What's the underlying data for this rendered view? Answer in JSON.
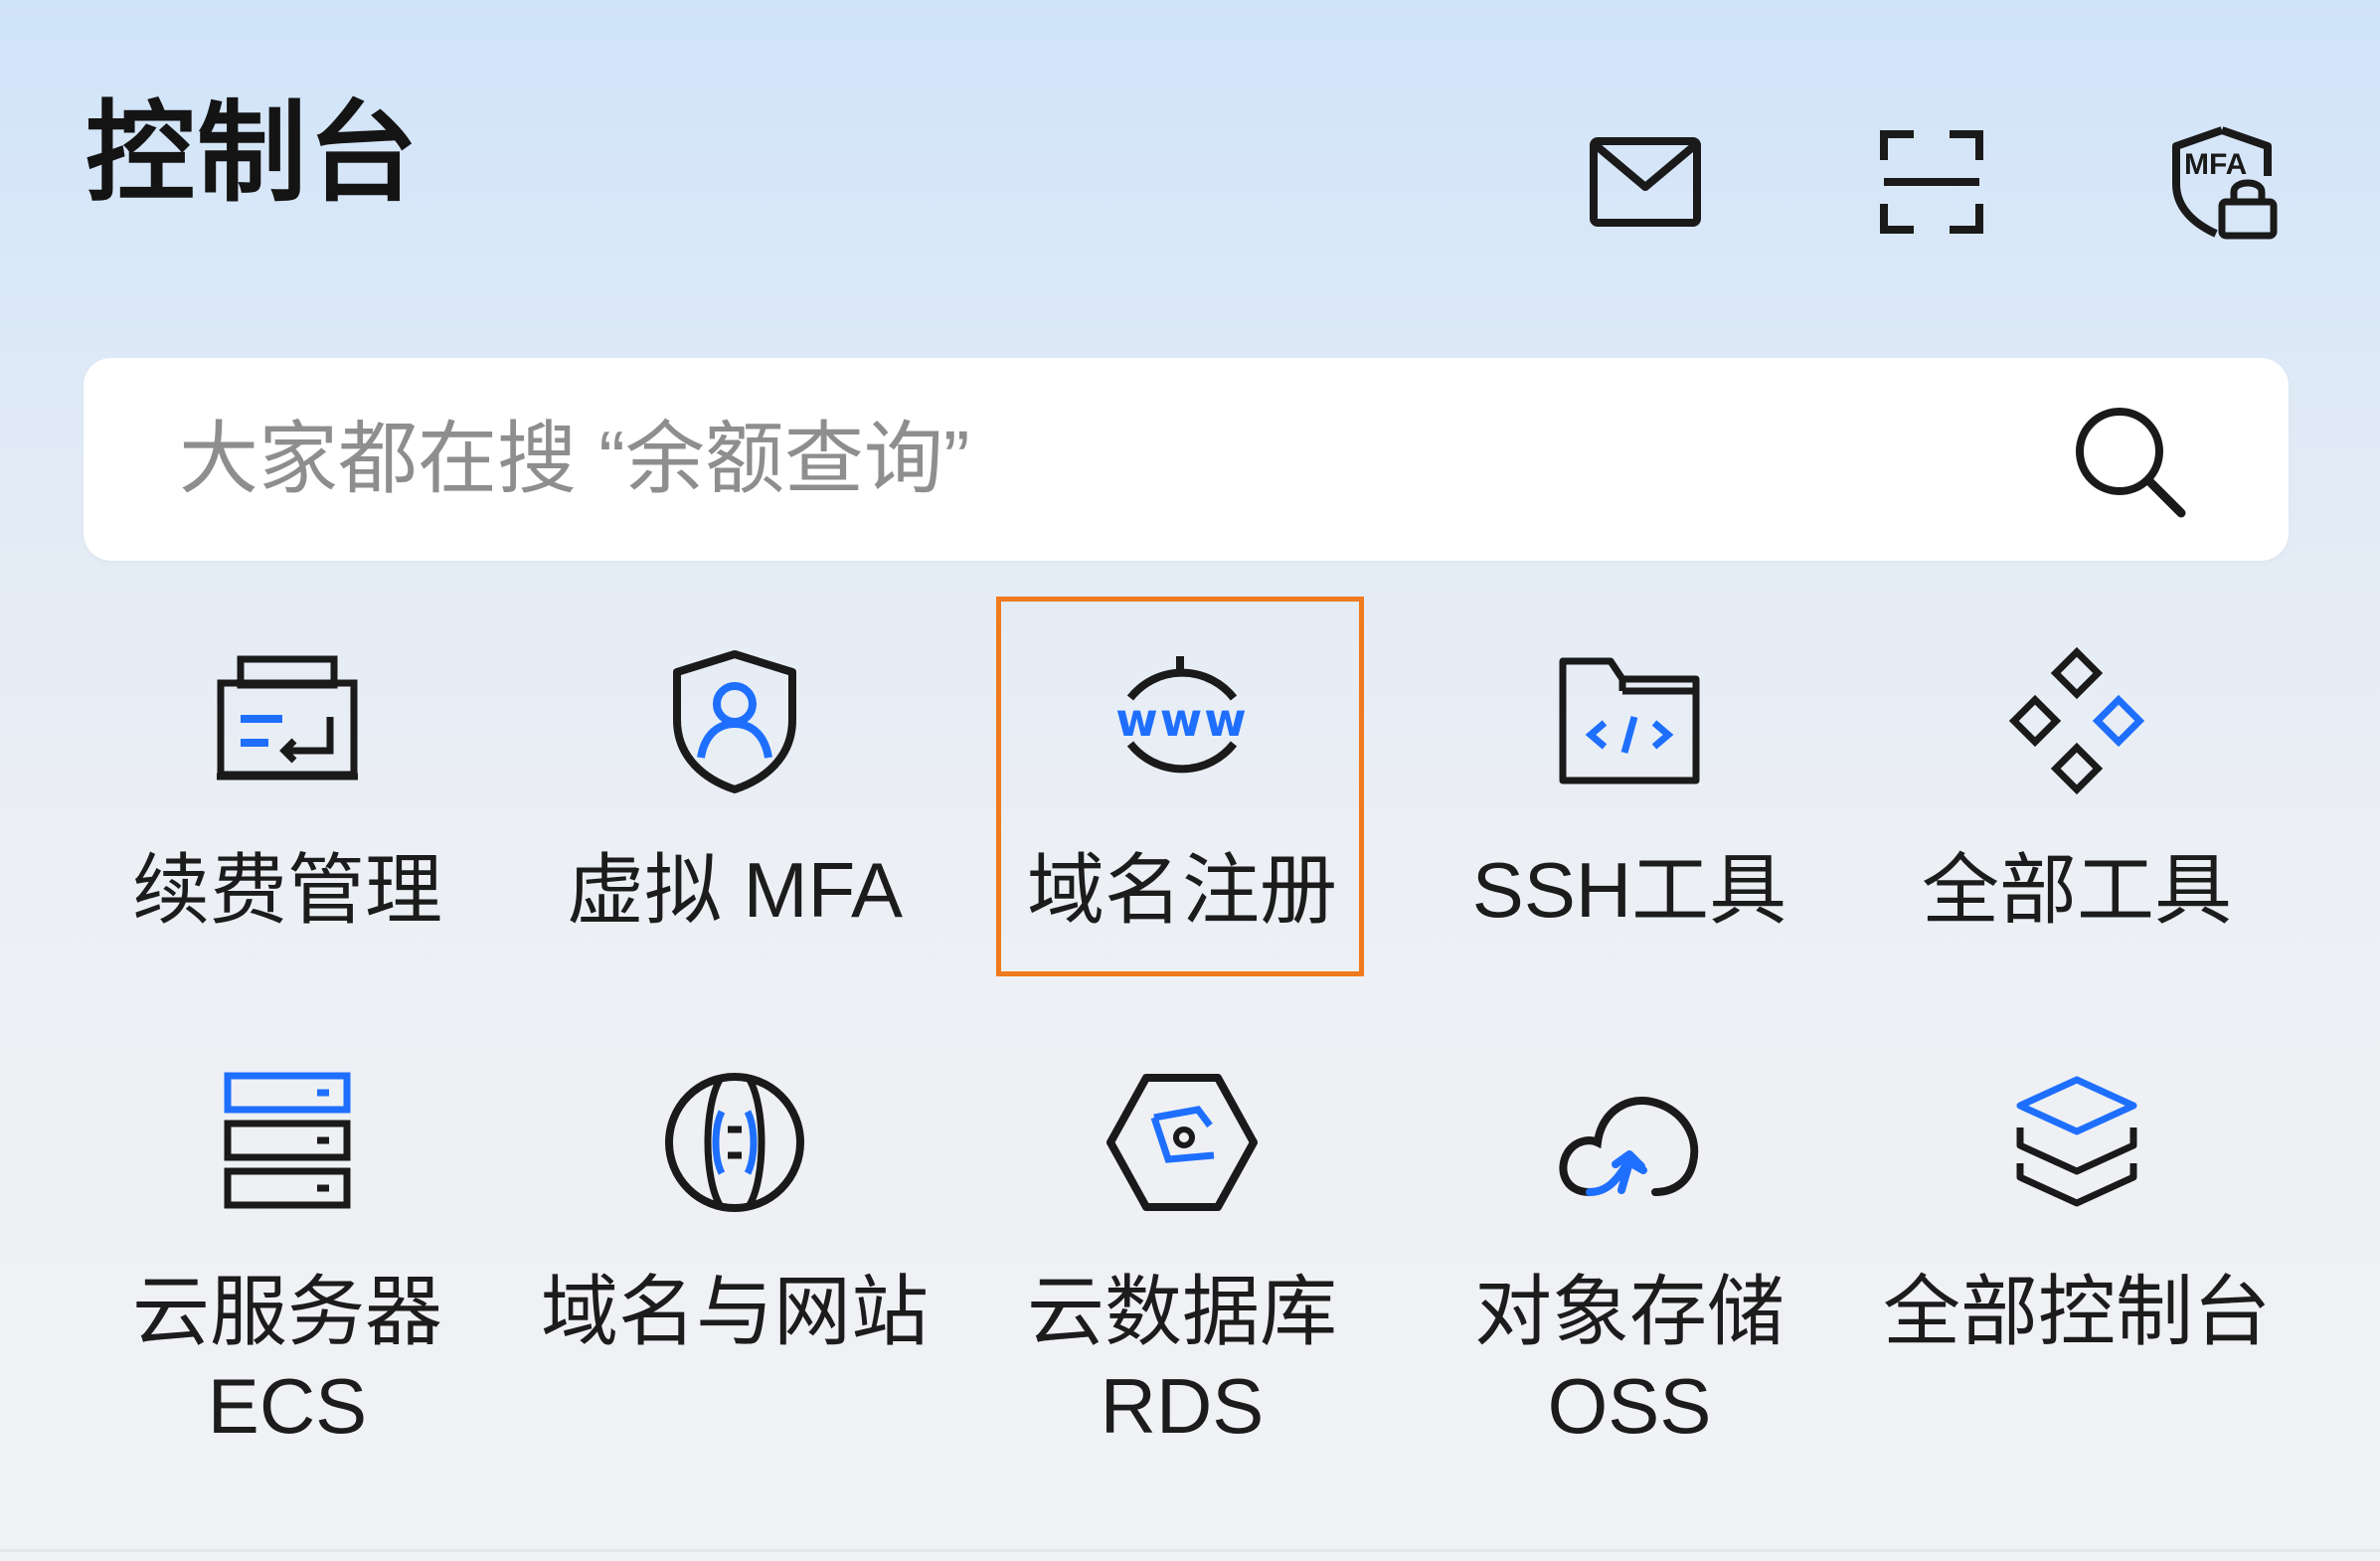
{
  "header": {
    "title": "控制台",
    "icons": [
      "mail-icon",
      "scan-icon",
      "mfa-lock-icon"
    ],
    "mfa_badge_text": "MFA"
  },
  "search": {
    "placeholder": "大家都在搜 “余额查询”"
  },
  "tools": [
    {
      "label": "续费管理",
      "icon": "renewal-icon"
    },
    {
      "label": "虚拟 MFA",
      "icon": "virtual-mfa-shield-icon"
    },
    {
      "label": "域名注册",
      "icon": "www-globe-icon",
      "highlighted": true
    },
    {
      "label": "SSH工具",
      "icon": "ssh-folder-icon"
    },
    {
      "label": "全部工具",
      "icon": "all-tools-icon"
    },
    {
      "label": "云服务器\nECS",
      "icon": "ecs-server-icon"
    },
    {
      "label": "域名与网站",
      "icon": "domain-website-icon"
    },
    {
      "label": "云数据库\nRDS",
      "icon": "rds-database-icon"
    },
    {
      "label": "对象存储\nOSS",
      "icon": "oss-cloud-icon"
    },
    {
      "label": "全部控制台",
      "icon": "all-console-layers-icon"
    }
  ],
  "colors": {
    "accent": "#1f6fff",
    "highlight": "#f07a1d",
    "icon_dark": "#1a1a1a"
  }
}
